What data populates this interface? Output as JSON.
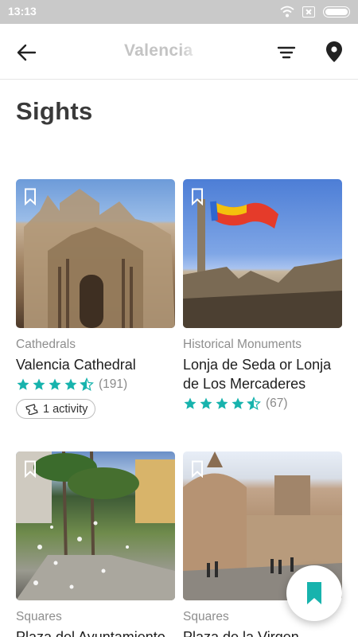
{
  "status_bar": {
    "time": "13:13"
  },
  "app_bar": {
    "title": "Valencia"
  },
  "page": {
    "title": "Sights"
  },
  "colors": {
    "accent": "#17b3ad",
    "star": "#17b3ad",
    "muted": "#8e8e8e"
  },
  "cards": [
    {
      "category": "Cathedrals",
      "title": "Valencia Cathedral",
      "rating": 4.5,
      "reviews": "(191)",
      "activity": "1 activity"
    },
    {
      "category": "Historical Monuments",
      "title": "Lonja de Seda or Lonja de Los Mercaderes",
      "rating": 4.5,
      "reviews": "(67)"
    },
    {
      "category": "Squares",
      "title": "Plaza del Ayuntamiento"
    },
    {
      "category": "Squares",
      "title": "Plaza de la Virgen"
    }
  ]
}
